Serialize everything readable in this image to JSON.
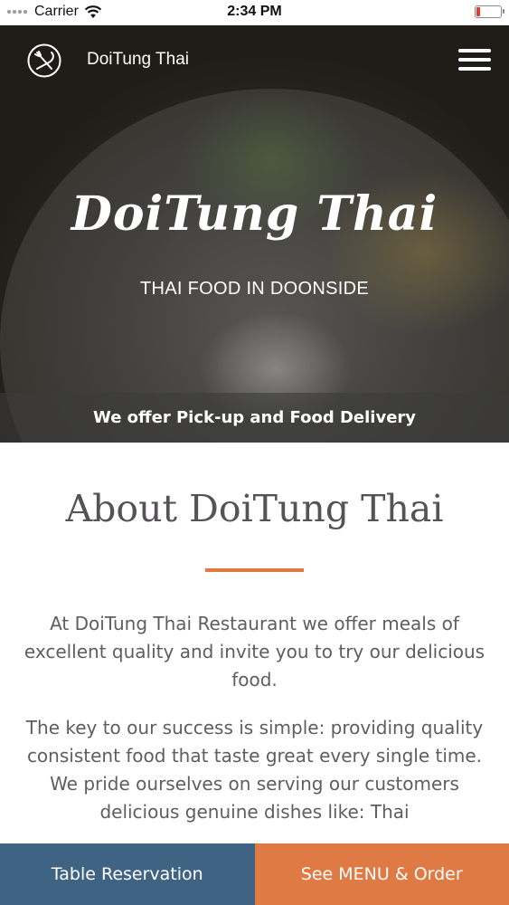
{
  "status_bar": {
    "carrier": "Carrier",
    "time": "2:34 PM",
    "wifi_icon": "wifi-icon",
    "battery_icon": "battery-low-icon"
  },
  "header": {
    "brand": "DoiTung Thai",
    "logo_icon": "fork-knife-icon",
    "menu_icon": "hamburger-menu-icon"
  },
  "hero": {
    "title": "DoiTung Thai",
    "subtitle": "THAI FOOD IN DOONSIDE",
    "band_text": "We offer Pick-up and Food Delivery"
  },
  "about": {
    "title": "About DoiTung Thai",
    "paragraphs": [
      "At DoiTung Thai Restaurant we offer meals of excellent quality and invite you to try our delicious food.",
      "The key to our success is simple: providing quality consistent food that taste great every single time. We pride ourselves on serving our customers delicious genuine dishes like: Thai"
    ]
  },
  "bottom_bar": {
    "reservation_label": "Table Reservation",
    "menu_label": "See MENU & Order"
  },
  "colors": {
    "accent_orange": "#e07a45",
    "reservation_blue": "#3f6383",
    "text_gray": "#5e5e5e"
  }
}
